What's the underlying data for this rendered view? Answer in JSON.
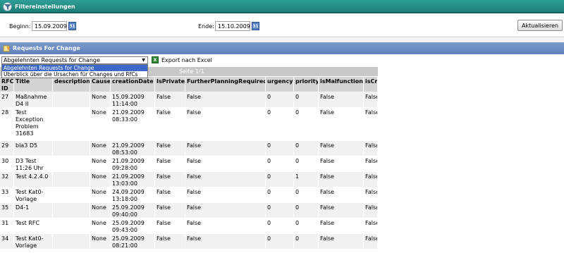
{
  "filter": {
    "title": "Filtereinstellungen",
    "begin_label": "Beginn:",
    "begin_value": "15.09.2009",
    "end_label": "Ende:",
    "end_value": "15.10.2009",
    "calendar_icon_text": "31",
    "refresh_label": "Aktualisieren"
  },
  "requests": {
    "title": "Requests For Change",
    "report_select": {
      "value": "Abgelehnten Requests for Change",
      "options": [
        "Abgelehnten Requests for Change",
        "Überblick über die Ursachen für Changes und RfCs"
      ]
    },
    "export_label": "Export nach Excel",
    "excel_icon_text": "X",
    "page_label": "Seite 1/1"
  },
  "table": {
    "columns": [
      "RFC ID",
      "Title",
      "description",
      "Cause",
      "creationDate",
      "IsPrivate",
      "FurtherPlanningRequired",
      "urgency",
      "priority",
      "isMalfunction",
      "isCri"
    ],
    "rows": [
      [
        "27",
        "Maßnahme D4 II",
        "",
        "None",
        "15.09.2009 11:14:00",
        "False",
        "False",
        "0",
        "0",
        "False",
        "False"
      ],
      [
        "28",
        "Test Exception Problem 31683",
        "",
        "None",
        "21.09.2009 08:33:00",
        "False",
        "False",
        "0",
        "0",
        "False",
        "False"
      ],
      [
        "29",
        "bla3 D5",
        "",
        "None",
        "21.09.2009 08:53:00",
        "False",
        "False",
        "0",
        "0",
        "False",
        "False"
      ],
      [
        "30",
        "D3 Test 11:26 Uhr",
        "",
        "None",
        "21.09.2009 09:28:00",
        "False",
        "False",
        "0",
        "0",
        "False",
        "False"
      ],
      [
        "32",
        "Test 4.2.4.0",
        "",
        "None",
        "21.09.2009 13:03:00",
        "False",
        "False",
        "0",
        "1",
        "False",
        "False"
      ],
      [
        "33",
        "Test Kat0-Vorlage",
        "",
        "None",
        "24.09.2009 13:18:00",
        "False",
        "False",
        "0",
        "0",
        "False",
        "False"
      ],
      [
        "35",
        "D4-1",
        "",
        "None",
        "25.09.2009 09:40:00",
        "False",
        "False",
        "0",
        "0",
        "False",
        "False"
      ],
      [
        "31",
        "Test RFC",
        "",
        "None",
        "25.09.2009 09:43:00",
        "False",
        "False",
        "0",
        "0",
        "False",
        "False"
      ],
      [
        "34",
        "Test Kat0-Vorlage",
        "",
        "None",
        "25.09.2009 08:21:00",
        "False",
        "False",
        "0",
        "0",
        "False",
        "False"
      ]
    ]
  }
}
